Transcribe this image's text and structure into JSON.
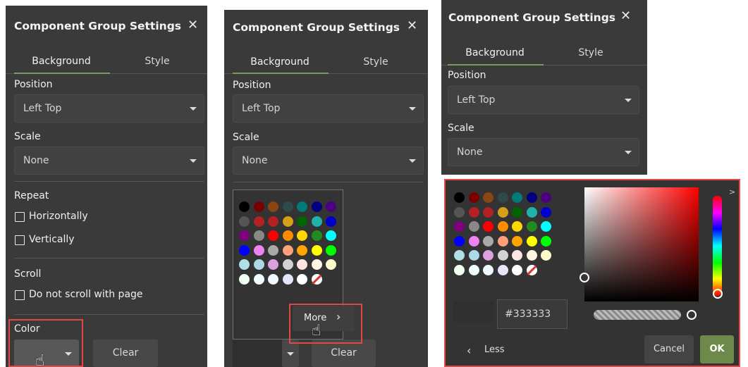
{
  "dialog": {
    "title": "Component Group Settings",
    "close": "✕"
  },
  "tabs": {
    "background": "Background",
    "style": "Style"
  },
  "position": {
    "label": "Position",
    "value": "Left Top"
  },
  "scale": {
    "label": "Scale",
    "value": "None"
  },
  "repeat": {
    "label": "Repeat",
    "horizontally": "Horizontally",
    "vertically": "Vertically"
  },
  "scroll": {
    "label": "Scroll",
    "option": "Do not scroll with page"
  },
  "color": {
    "label": "Color",
    "clear": "Clear",
    "more": "More",
    "current_hex": "#333333",
    "accent": "#e04848"
  },
  "picker": {
    "less": "Less",
    "cancel": "Cancel",
    "ok": "OK",
    "ok_color": "#6d8a4b"
  },
  "palette": [
    [
      "#000000",
      "#7a0000",
      "#8a4513",
      "#2e4a4a",
      "#007a7a",
      "#000080",
      "#4b0082"
    ],
    [
      "#555555",
      "#b22222",
      "#b22222",
      "#d4a017",
      "#006400",
      "#20b2aa",
      "#0000cd"
    ],
    [
      "#800080",
      "#888888",
      "#ff0000",
      "#ff8c00",
      "#ffd700",
      "#228b22",
      "#00ffff"
    ],
    [
      "#0000ff",
      "#ee82ee",
      "#a9a9a9",
      "#ffa07a",
      "#ffa500",
      "#ffff00",
      "#00ff00"
    ],
    [
      "#b0e0e6",
      "#add8e6",
      "#dda0dd",
      "#d3d3d3",
      "#ffe4e1",
      "#fff5e1",
      "#fffacd"
    ],
    [
      "#f0fff0",
      "#f0ffff",
      "#f0f8ff",
      "#e6e6fa",
      "#ffffff",
      "none"
    ]
  ]
}
